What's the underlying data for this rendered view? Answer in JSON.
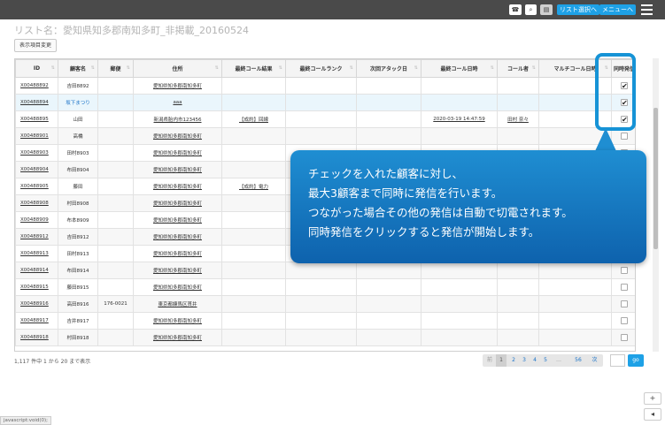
{
  "topbar": {
    "phone_icon": "phone-icon",
    "search_icon": "search-icon",
    "id_card_icon": "id-card-icon",
    "list_select_label": "リスト選択へ",
    "menu_label": "メニューへ",
    "hamburger_icon": "hamburger-icon"
  },
  "list_title": "リスト名：愛知県知多郡南知多町_非掲載_20160524",
  "column_toggle_label": "表示項目変更",
  "table": {
    "columns": [
      "ID",
      "顧客名",
      "郵便",
      "住所",
      "最終コール結果",
      "最終コールランク",
      "次回アタック日",
      "最終コール日時",
      "コール者",
      "マルチコール日時",
      "同時発信"
    ],
    "rows": [
      {
        "id": "X00488892",
        "name": "吉田8892",
        "zip": "",
        "addr": "愛知県知多郡南知多町",
        "result": "",
        "rank": "",
        "next": "",
        "last_time": "",
        "caller": "",
        "multi": "",
        "checked": true
      },
      {
        "id": "X00488894",
        "name": "坂下まつり",
        "zip": "",
        "addr": "aaa",
        "result": "",
        "rank": "",
        "next": "",
        "last_time": "",
        "caller": "",
        "multi": "",
        "checked": true
      },
      {
        "id": "X00488895",
        "name": "山田",
        "zip": "",
        "addr": "新潟県胎内市123456",
        "result": "【成約】回線",
        "rank": "",
        "next": "",
        "last_time": "2020-03-19 14:47:59",
        "caller": "田村 奈々",
        "multi": "",
        "checked": true
      },
      {
        "id": "X00488901",
        "name": "高橋",
        "zip": "",
        "addr": "愛知県知多郡南知多町",
        "result": "",
        "rank": "",
        "next": "",
        "last_time": "",
        "caller": "",
        "multi": "",
        "checked": false
      },
      {
        "id": "X00488903",
        "name": "田村8903",
        "zip": "",
        "addr": "愛知県知多郡南知多町",
        "result": "",
        "rank": "",
        "next": "",
        "last_time": "",
        "caller": "",
        "multi": "",
        "checked": false
      },
      {
        "id": "X00488904",
        "name": "布田8904",
        "zip": "",
        "addr": "愛知県知多郡南知多町",
        "result": "",
        "rank": "",
        "next": "",
        "last_time": "",
        "caller": "",
        "multi": "",
        "checked": false
      },
      {
        "id": "X00488905",
        "name": "藤田",
        "zip": "",
        "addr": "愛知県知多郡南知多町",
        "result": "【成約】電力",
        "rank": "",
        "next": "",
        "last_time": "",
        "caller": "",
        "multi": "",
        "checked": false
      },
      {
        "id": "X00488908",
        "name": "村田8908",
        "zip": "",
        "addr": "愛知県知多郡南知多町",
        "result": "",
        "rank": "",
        "next": "",
        "last_time": "",
        "caller": "",
        "multi": "",
        "checked": false
      },
      {
        "id": "X00488909",
        "name": "布本8909",
        "zip": "",
        "addr": "愛知県知多郡南知多町",
        "result": "",
        "rank": "",
        "next": "",
        "last_time": "",
        "caller": "",
        "multi": "",
        "checked": false
      },
      {
        "id": "X00488912",
        "name": "吉田8912",
        "zip": "",
        "addr": "愛知県知多郡南知多町",
        "result": "",
        "rank": "",
        "next": "",
        "last_time": "",
        "caller": "",
        "multi": "",
        "checked": false
      },
      {
        "id": "X00488913",
        "name": "田村8913",
        "zip": "",
        "addr": "愛知県知多郡南知多町",
        "result": "",
        "rank": "",
        "next": "",
        "last_time": "",
        "caller": "",
        "multi": "",
        "checked": false
      },
      {
        "id": "X00488914",
        "name": "布田8914",
        "zip": "",
        "addr": "愛知県知多郡南知多町",
        "result": "",
        "rank": "",
        "next": "",
        "last_time": "",
        "caller": "",
        "multi": "",
        "checked": false
      },
      {
        "id": "X00488915",
        "name": "藤田8915",
        "zip": "",
        "addr": "愛知県知多郡南知多町",
        "result": "",
        "rank": "",
        "next": "",
        "last_time": "",
        "caller": "",
        "multi": "",
        "checked": false
      },
      {
        "id": "X00488916",
        "name": "高田8916",
        "zip": "176-0021",
        "addr": "東京都練馬区貫井",
        "result": "",
        "rank": "",
        "next": "",
        "last_time": "",
        "caller": "",
        "multi": "",
        "checked": false
      },
      {
        "id": "X00488917",
        "name": "吉井8917",
        "zip": "",
        "addr": "愛知県知多郡南知多町",
        "result": "",
        "rank": "",
        "next": "",
        "last_time": "",
        "caller": "",
        "multi": "",
        "checked": false
      },
      {
        "id": "X00488918",
        "name": "村田8918",
        "zip": "",
        "addr": "愛知県知多郡南知多町",
        "result": "",
        "rank": "",
        "next": "",
        "last_time": "",
        "caller": "",
        "multi": "",
        "checked": false
      }
    ]
  },
  "callout": {
    "lines": [
      "チェックを入れた顧客に対し、",
      "最大3顧客まで同時に発信を行います。",
      "つながった場合その他の発信は自動で切電されます。",
      "同時発信をクリックすると発信が開始します。"
    ]
  },
  "footer": {
    "info": "1,117 件中 1 から 20 まで表示",
    "pagination": {
      "prev": "前",
      "pages": [
        "1",
        "2",
        "3",
        "4",
        "5"
      ],
      "ellipsis": "…",
      "last": "56",
      "next": "次"
    },
    "go_label": "go"
  },
  "side_buttons": {
    "plus": "+",
    "left": "◂"
  },
  "status_text": "javascript:void(0);"
}
